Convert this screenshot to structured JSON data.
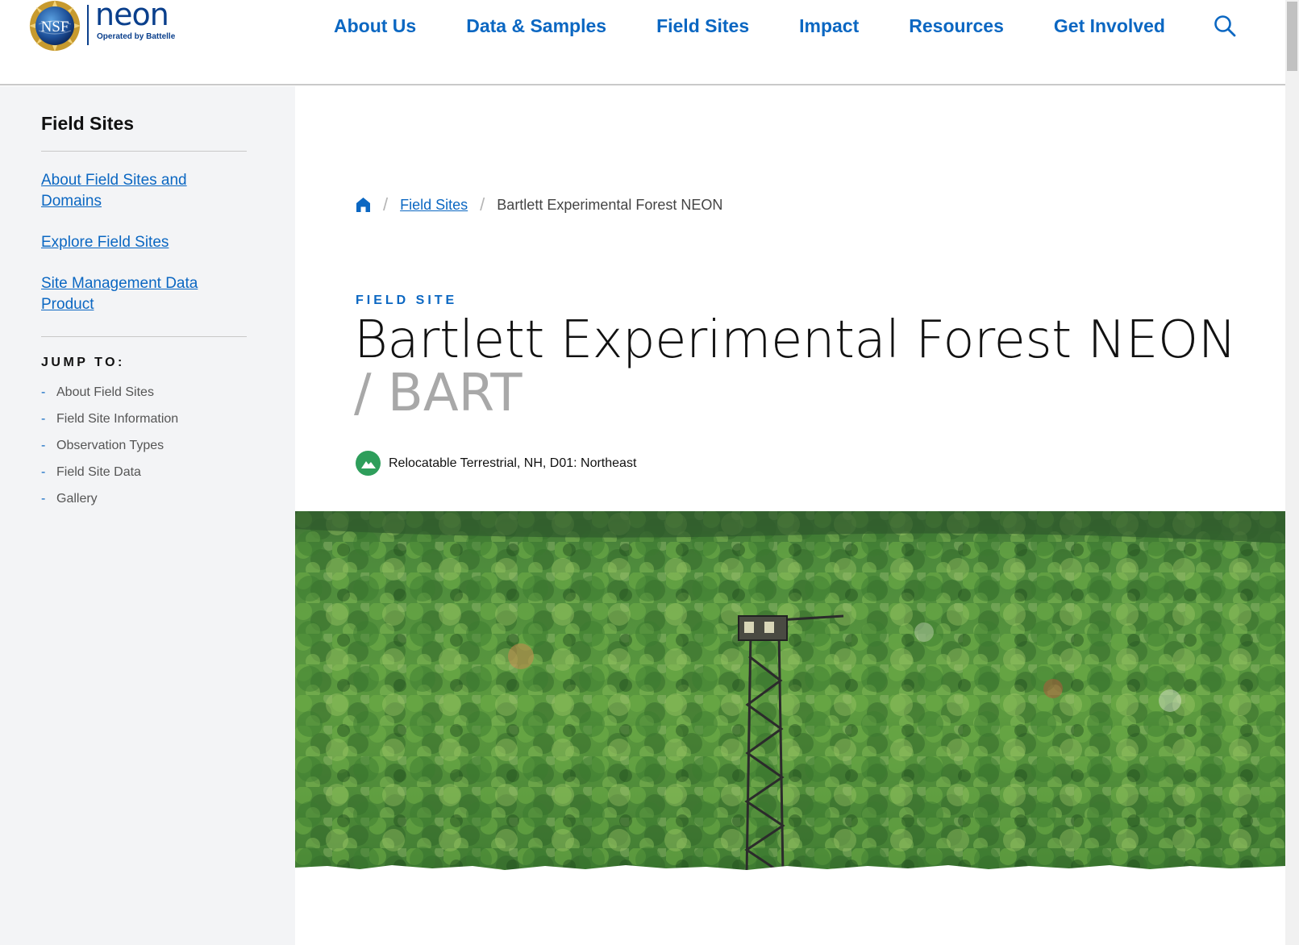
{
  "header": {
    "logo": {
      "seal_text": "NSF",
      "wordmark": "neon",
      "tagline": "Operated by Battelle"
    },
    "nav": [
      {
        "label": "About Us"
      },
      {
        "label": "Data & Samples"
      },
      {
        "label": "Field Sites"
      },
      {
        "label": "Impact"
      },
      {
        "label": "Resources"
      },
      {
        "label": "Get Involved"
      }
    ],
    "search_icon": "search-icon"
  },
  "sidebar": {
    "title": "Field Sites",
    "links": [
      {
        "label": "About Field Sites and Domains"
      },
      {
        "label": "Explore Field Sites"
      },
      {
        "label": "Site Management Data Product"
      }
    ],
    "jump_title": "JUMP TO:",
    "jump_items": [
      {
        "dash": "-",
        "label": "About Field Sites"
      },
      {
        "dash": "-",
        "label": "Field Site Information"
      },
      {
        "dash": "-",
        "label": "Observation Types"
      },
      {
        "dash": "-",
        "label": "Field Site Data"
      },
      {
        "dash": "-",
        "label": "Gallery"
      }
    ]
  },
  "main": {
    "breadcrumb": {
      "home_icon": "home-icon",
      "separator": "/",
      "link": "Field Sites",
      "current": "Bartlett Experimental Forest NEON"
    },
    "eyebrow": "FIELD SITE",
    "title": "Bartlett Experimental Forest NEON",
    "code": "/ BART",
    "meta": {
      "icon": "mountain-icon",
      "text": "Relocatable Terrestrial, NH, D01: Northeast"
    },
    "hero_image": "aerial-forest-tower-photo"
  },
  "colors": {
    "link_blue": "#0b67c2",
    "brand_navy": "#0a3f8c",
    "sidebar_bg": "#f3f4f6",
    "meta_green": "#2e9e5b",
    "muted_gray": "#a8a8a8"
  }
}
